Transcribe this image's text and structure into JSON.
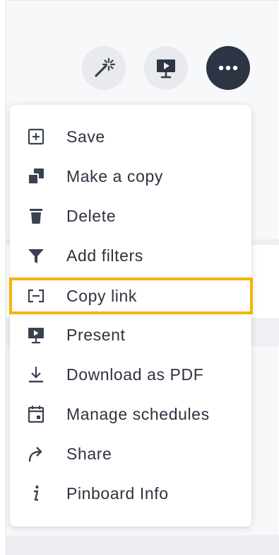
{
  "toolbar": {
    "buttons": [
      {
        "icon": "magic-wand-icon"
      },
      {
        "icon": "presentation-icon"
      },
      {
        "icon": "more-options-icon"
      }
    ]
  },
  "menu": {
    "items": [
      {
        "label": "Save",
        "icon": "save-plus-box-icon"
      },
      {
        "label": "Make a copy",
        "icon": "copy-icon"
      },
      {
        "label": "Delete",
        "icon": "trash-icon"
      },
      {
        "label": "Add filters",
        "icon": "filter-icon"
      },
      {
        "label": "Copy link",
        "icon": "link-icon",
        "highlighted": true
      },
      {
        "label": "Present",
        "icon": "presentation-icon"
      },
      {
        "label": "Download as PDF",
        "icon": "download-icon"
      },
      {
        "label": "Manage schedules",
        "icon": "calendar-icon"
      },
      {
        "label": "Share",
        "icon": "share-arrow-icon"
      },
      {
        "label": "Pinboard Info",
        "icon": "info-icon"
      }
    ]
  },
  "colors": {
    "highlight": "#f5b400",
    "icon": "#3a4251",
    "text": "#2c3340",
    "more_button_bg": "#2d3544"
  }
}
